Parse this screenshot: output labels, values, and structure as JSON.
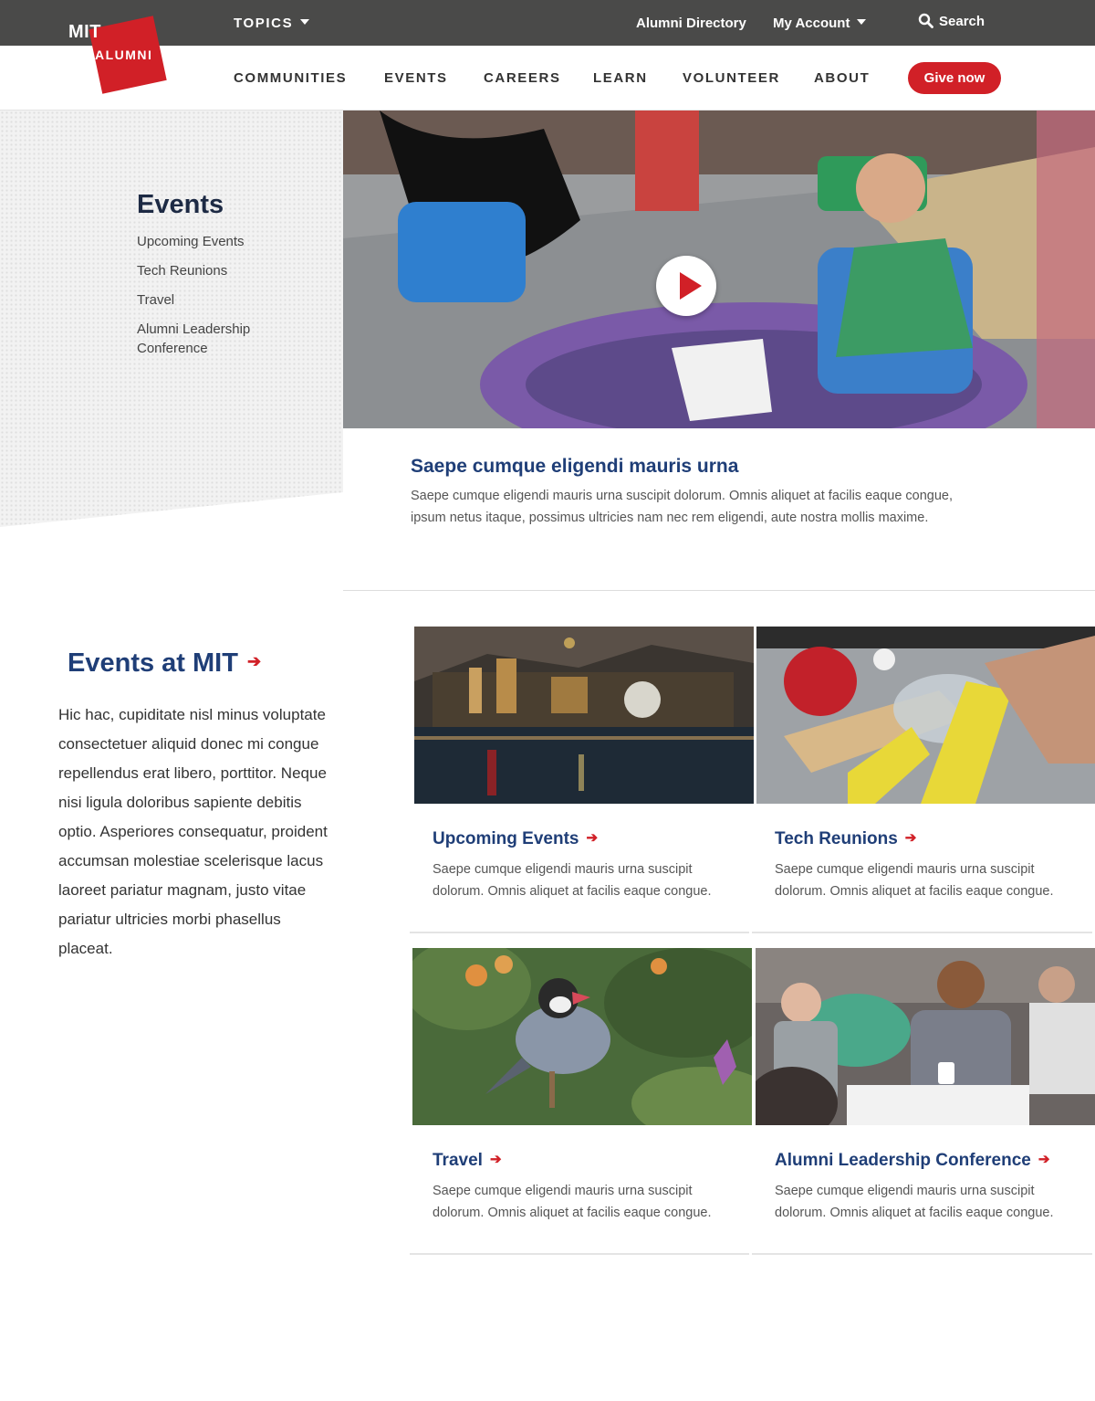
{
  "topbar": {
    "topics_label": "TOPICS",
    "alumni_directory": "Alumni Directory",
    "my_account": "My Account",
    "search_label": "Search"
  },
  "logo": {
    "line1": "MIT",
    "line2": "ALUMNI"
  },
  "nav": {
    "items": [
      "COMMUNITIES",
      "EVENTS",
      "CAREERS",
      "LEARN",
      "VOLUNTEER",
      "ABOUT"
    ],
    "give_label": "Give now"
  },
  "sidebar": {
    "title": "Events",
    "links": [
      "Upcoming Events",
      "Tech Reunions",
      "Travel",
      "Alumni Leadership Conference"
    ]
  },
  "hero": {
    "title": "Saepe cumque eligendi mauris urna",
    "description": "Saepe cumque eligendi mauris urna suscipit dolorum. Omnis aliquet at facilis eaque congue, ipsum netus itaque, possimus ultricies nam nec rem eligendi, aute nostra mollis maxime."
  },
  "events_section": {
    "title": "Events at MIT",
    "arrow": "➔",
    "body": "Hic hac, cupiditate nisl minus voluptate consectetuer aliquid donec mi congue repellendus erat libero, porttitor. Neque nisi ligula doloribus sapiente debitis optio. Asperiores consequatur, proident accumsan molestiae scelerisque lacus laoreet pariatur magnam, justo vitae pariatur ultricies morbi phasellus placeat."
  },
  "cards": [
    {
      "title": "Upcoming Events",
      "description": "Saepe cumque eligendi mauris urna suscipit dolorum. Omnis aliquet at facilis eaque congue."
    },
    {
      "title": "Tech Reunions",
      "description": "Saepe cumque eligendi mauris urna suscipit dolorum. Omnis aliquet at facilis eaque congue."
    },
    {
      "title": "Travel",
      "description": "Saepe cumque eligendi mauris urna suscipit dolorum. Omnis aliquet at facilis eaque congue."
    },
    {
      "title": "Alumni Leadership Conference",
      "description": "Saepe cumque eligendi mauris urna suscipit dolorum. Omnis aliquet at facilis eaque congue."
    }
  ],
  "colors": {
    "brand_red": "#d12027",
    "heading_blue": "#1f3e77",
    "topbar_gray": "#4a4a49"
  }
}
